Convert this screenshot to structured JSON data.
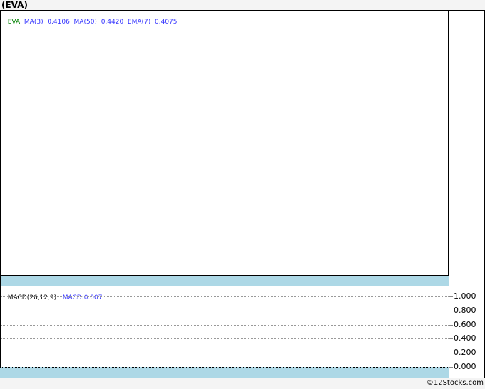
{
  "title": "(EVA)",
  "legend": {
    "symbol": "EVA",
    "ma3_label": "MA(3)",
    "ma3_value": "0.4106",
    "ma50_label": "MA(50)",
    "ma50_value": "0.4420",
    "ema7_label": "EMA(7)",
    "ema7_value": "0.4075"
  },
  "macd_legend": {
    "label": "MACD(26,12,9)",
    "value": "MACD:0.007"
  },
  "chart_data": {
    "type": "line",
    "series": [],
    "macd_panel": {
      "yticks": [
        "1.000",
        "0.800",
        "0.600",
        "0.400",
        "0.200",
        "0.000"
      ],
      "ylim": [
        0,
        1
      ],
      "grid": true
    }
  },
  "colors": {
    "band": "#add8e6",
    "symbol": "#008000",
    "indicator": "#3333ff"
  },
  "footer": "©12Stocks.com"
}
